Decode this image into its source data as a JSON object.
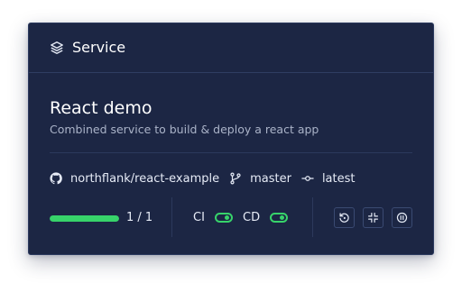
{
  "header": {
    "title": "Service",
    "icon": "layers-icon"
  },
  "service": {
    "name": "React demo",
    "description": "Combined service to build & deploy a react app"
  },
  "meta": {
    "repo": "northflank/react-example",
    "repo_icon": "github-icon",
    "branch": "master",
    "branch_icon": "git-branch-icon",
    "commit": "latest",
    "commit_icon": "git-commit-icon"
  },
  "status": {
    "instances_label": "1 / 1",
    "instances_fraction": 1.0,
    "ci_label": "CI",
    "ci_enabled": true,
    "cd_label": "CD",
    "cd_enabled": true
  },
  "actions": [
    {
      "name": "restart-icon"
    },
    {
      "name": "scale-icon"
    },
    {
      "name": "pause-icon"
    }
  ],
  "colors": {
    "card_bg": "#1c2644",
    "accent_green": "#37d36a",
    "muted_text": "#aab3c8"
  }
}
